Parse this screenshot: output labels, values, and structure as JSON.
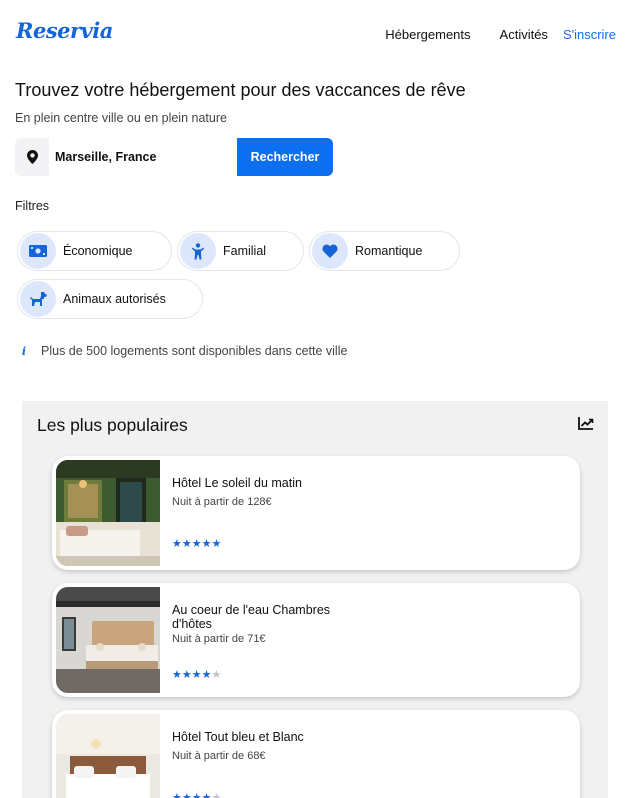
{
  "header": {
    "logo": "Reservia",
    "nav": [
      "Hébergements",
      "Activités",
      "S'inscrire"
    ]
  },
  "hero": {
    "title": "Trouvez votre hébergement pour des vaccances de rêve",
    "subtitle": "En plein centre ville ou en plein nature"
  },
  "search": {
    "value": "Marseille, France",
    "button": "Rechercher",
    "icon": "map-pin-icon"
  },
  "filters": {
    "label": "Filtres",
    "items": [
      {
        "label": "Économique",
        "icon": "money-icon"
      },
      {
        "label": "Familial",
        "icon": "child-icon"
      },
      {
        "label": "Romantique",
        "icon": "heart-icon"
      },
      {
        "label": "Animaux autorisés",
        "icon": "dog-icon"
      }
    ]
  },
  "info": {
    "text": "Plus de 500 logements sont disponibles dans cette ville",
    "icon": "info-icon"
  },
  "popular": {
    "title": "Les plus populaires",
    "icon": "trend-chart-icon",
    "cards": [
      {
        "name": "Hôtel Le soleil du matin",
        "price": "Nuit à partir de 128€",
        "rating": 5
      },
      {
        "name": "Au coeur de l'eau Chambres d'hôtes",
        "price": "Nuit à partir de 71€",
        "rating": 4
      },
      {
        "name": "Hôtel Tout bleu et Blanc",
        "price": "Nuit à partir de 68€",
        "rating": 4
      }
    ]
  },
  "colors": {
    "brand": "#1565d8",
    "button": "#0b6ff0",
    "chip_icon_bg": "#dde7fb",
    "section_bg": "#f1f1f1"
  }
}
